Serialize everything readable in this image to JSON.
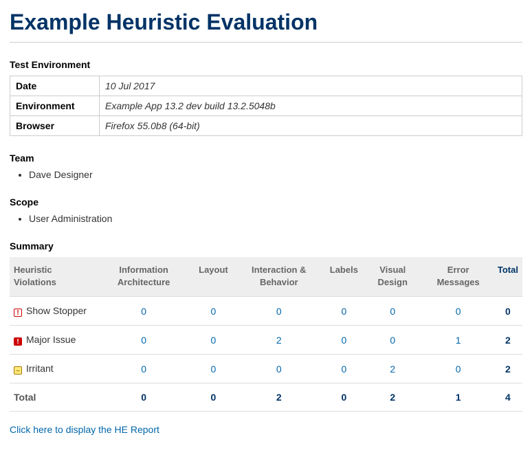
{
  "title": "Example Heuristic Evaluation",
  "sections": {
    "test_env": "Test Environment",
    "team": "Team",
    "scope": "Scope",
    "summary": "Summary"
  },
  "env": {
    "date_label": "Date",
    "date_value": "10 Jul 2017",
    "environment_label": "Environment",
    "environment_value": "Example App 13.2 dev build 13.2.5048b",
    "browser_label": "Browser",
    "browser_value": "Firefox 55.0b8 (64-bit)"
  },
  "team": [
    "Dave Designer"
  ],
  "scope": [
    "User Administration"
  ],
  "summary": {
    "columns": {
      "row_header": "Heuristic Violations",
      "info_arch": "Information Architecture",
      "layout": "Layout",
      "interaction": "Interaction & Behavior",
      "labels": "Labels",
      "visual": "Visual Design",
      "errors": "Error Messages",
      "total": "Total"
    },
    "rows": [
      {
        "key": "show_stopper",
        "label": "Show Stopper",
        "icon_glyph": "!",
        "icon_class": "sev-stopper",
        "values": {
          "info_arch": 0,
          "layout": 0,
          "interaction": 0,
          "labels": 0,
          "visual": 0,
          "errors": 0,
          "total": 0
        }
      },
      {
        "key": "major_issue",
        "label": "Major Issue",
        "icon_glyph": "!",
        "icon_class": "sev-major",
        "values": {
          "info_arch": 0,
          "layout": 0,
          "interaction": 2,
          "labels": 0,
          "visual": 0,
          "errors": 1,
          "total": 2
        }
      },
      {
        "key": "irritant",
        "label": "Irritant",
        "icon_glyph": "–",
        "icon_class": "sev-irritant",
        "values": {
          "info_arch": 0,
          "layout": 0,
          "interaction": 0,
          "labels": 0,
          "visual": 2,
          "errors": 0,
          "total": 2
        }
      }
    ],
    "totals": {
      "label": "Total",
      "info_arch": 0,
      "layout": 0,
      "interaction": 2,
      "labels": 0,
      "visual": 2,
      "errors": 1,
      "total": 4
    }
  },
  "report_link_text": "Click here to display the HE Report",
  "chart_data": {
    "type": "table",
    "title": "Heuristic Violations",
    "columns": [
      "Information Architecture",
      "Layout",
      "Interaction & Behavior",
      "Labels",
      "Visual Design",
      "Error Messages",
      "Total"
    ],
    "rows": [
      {
        "name": "Show Stopper",
        "values": [
          0,
          0,
          0,
          0,
          0,
          0,
          0
        ]
      },
      {
        "name": "Major Issue",
        "values": [
          0,
          0,
          2,
          0,
          0,
          1,
          2
        ]
      },
      {
        "name": "Irritant",
        "values": [
          0,
          0,
          0,
          0,
          2,
          0,
          2
        ]
      },
      {
        "name": "Total",
        "values": [
          0,
          0,
          2,
          0,
          2,
          1,
          4
        ]
      }
    ]
  }
}
